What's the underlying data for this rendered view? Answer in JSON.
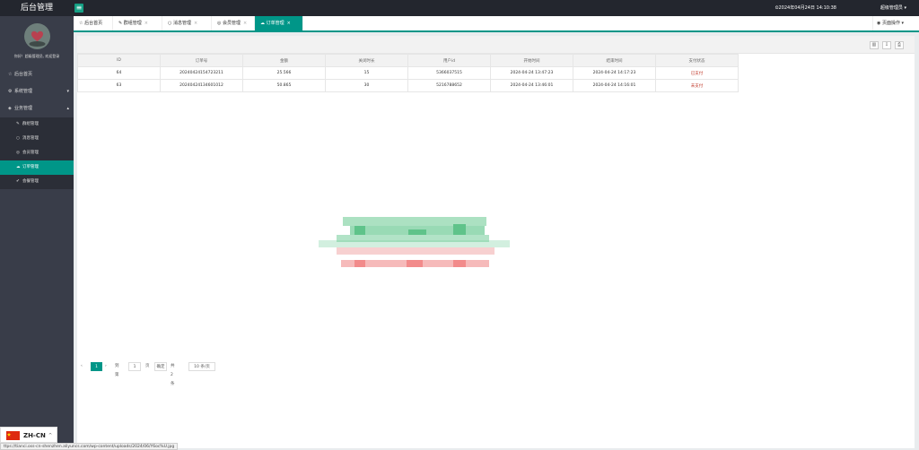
{
  "header": {
    "brand": "后台管理",
    "menu_icon": "hamburger-icon",
    "clock": "⏲2024年04月24日 14:10:38",
    "user": "超级管理员 ▾"
  },
  "sidebar": {
    "welcome": "你好！超级管理员, 欢迎登录",
    "items": [
      {
        "label": "后台首页",
        "icon": "home-icon"
      },
      {
        "label": "系统管理",
        "icon": "gear-icon"
      },
      {
        "label": "业务管理",
        "icon": "layers-icon"
      }
    ],
    "sub_items": [
      {
        "label": "群组管理"
      },
      {
        "label": "消息管理"
      },
      {
        "label": "会员管理"
      },
      {
        "label": "订单管理"
      },
      {
        "label": "会餐管理"
      }
    ]
  },
  "tabs": [
    {
      "label": "后台首页"
    },
    {
      "label": "群组管理"
    },
    {
      "label": "消息管理"
    },
    {
      "label": "会员管理"
    },
    {
      "label": "订单管理"
    }
  ],
  "page_ops": "页面操作 ▾",
  "table": {
    "columns": [
      "ID",
      "订单号",
      "金额",
      "关闭时长",
      "用户id",
      "开始时间",
      "结束时间",
      "支付状态"
    ],
    "rows": [
      [
        "64",
        "20240424154723211",
        "25.566",
        "15",
        "5366037515",
        "2024-04-24 13:47:23",
        "2024-04-24 14:17:23",
        "已支付"
      ],
      [
        "63",
        "20240424134601012",
        "50.865",
        "30",
        "5216788652",
        "2024-04-24 13:46:01",
        "2024-04-24 14:16:01",
        "未支付"
      ]
    ]
  },
  "pager": {
    "current": "1",
    "goto_label": "到第",
    "goto_value": "1",
    "page_unit": "页",
    "confirm": "确定",
    "total": "共 2 条",
    "per_page": "10 条/页"
  },
  "lang": {
    "label": "ZH-CN"
  },
  "status_url": "ttps://tianci.oss-cn-shenzhen.aliyuncs.com/wp-content/uploads/2024/06/Y6oc%U.jpg",
  "colors": {
    "accent": "#009688",
    "sidebar": "#393d49",
    "topbar": "#23262e"
  }
}
